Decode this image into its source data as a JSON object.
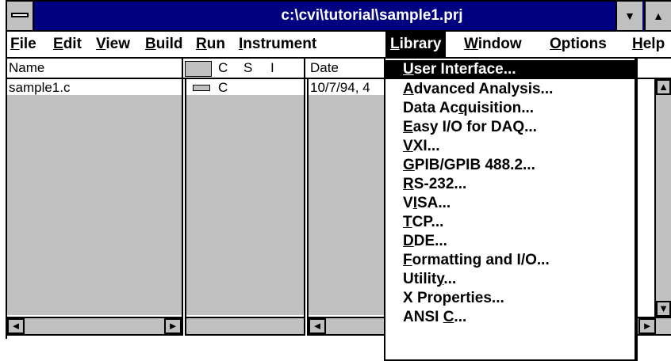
{
  "window": {
    "title": "c:\\cvi\\tutorial\\sample1.prj",
    "scroll_up_glyph": "▲",
    "scroll_down_glyph": "▼"
  },
  "menubar": {
    "items": [
      {
        "label": "File",
        "key": "F",
        "rest": "ile"
      },
      {
        "label": "Edit",
        "key": "E",
        "rest": "dit"
      },
      {
        "label": "View",
        "key": "V",
        "rest": "iew"
      },
      {
        "label": "Build",
        "key": "B",
        "rest": "uild"
      },
      {
        "label": "Run",
        "key": "R",
        "rest": "un"
      },
      {
        "label": "Instrument",
        "key": "I",
        "rest": "nstrument"
      },
      {
        "label": "Library",
        "key": "L",
        "rest": "ibrary"
      },
      {
        "label": "Window",
        "key": "W",
        "rest": "indow"
      },
      {
        "label": "Options",
        "key": "O",
        "rest": "ptions"
      },
      {
        "label": "Help",
        "key": "H",
        "rest": "elp"
      }
    ]
  },
  "file_list": {
    "columns": {
      "name": "Name",
      "c": "C",
      "s": "S",
      "i": "I",
      "date": "Date"
    },
    "rows": [
      {
        "name": "sample1.c",
        "c": "C",
        "date": "10/7/94, 4"
      }
    ]
  },
  "library_menu": {
    "items": [
      {
        "pre": "",
        "key": "U",
        "post": "ser Interface..."
      },
      {
        "pre": "",
        "key": "A",
        "post": "dvanced Analysis..."
      },
      {
        "pre": "Data Ac",
        "key": "q",
        "post": "uisition..."
      },
      {
        "pre": "",
        "key": "E",
        "post": "asy I/O for DAQ..."
      },
      {
        "pre": "",
        "key": "V",
        "post": "XI..."
      },
      {
        "pre": "",
        "key": "G",
        "post": "PIB/GPIB 488.2..."
      },
      {
        "pre": "",
        "key": "R",
        "post": "S-232..."
      },
      {
        "pre": "V",
        "key": "I",
        "post": "SA..."
      },
      {
        "pre": "",
        "key": "T",
        "post": "CP..."
      },
      {
        "pre": "",
        "key": "D",
        "post": "DE..."
      },
      {
        "pre": "",
        "key": "F",
        "post": "ormatting and I/O..."
      },
      {
        "pre": "Utilit",
        "key": "y",
        "post": "..."
      },
      {
        "pre": "X Properties...",
        "key": "",
        "post": ""
      },
      {
        "pre": "ANSI ",
        "key": "C",
        "post": "..."
      }
    ]
  },
  "scroll": {
    "left_arrow": "◄",
    "right_arrow": "►",
    "up_arrow": "▲",
    "down_arrow": "▼"
  }
}
